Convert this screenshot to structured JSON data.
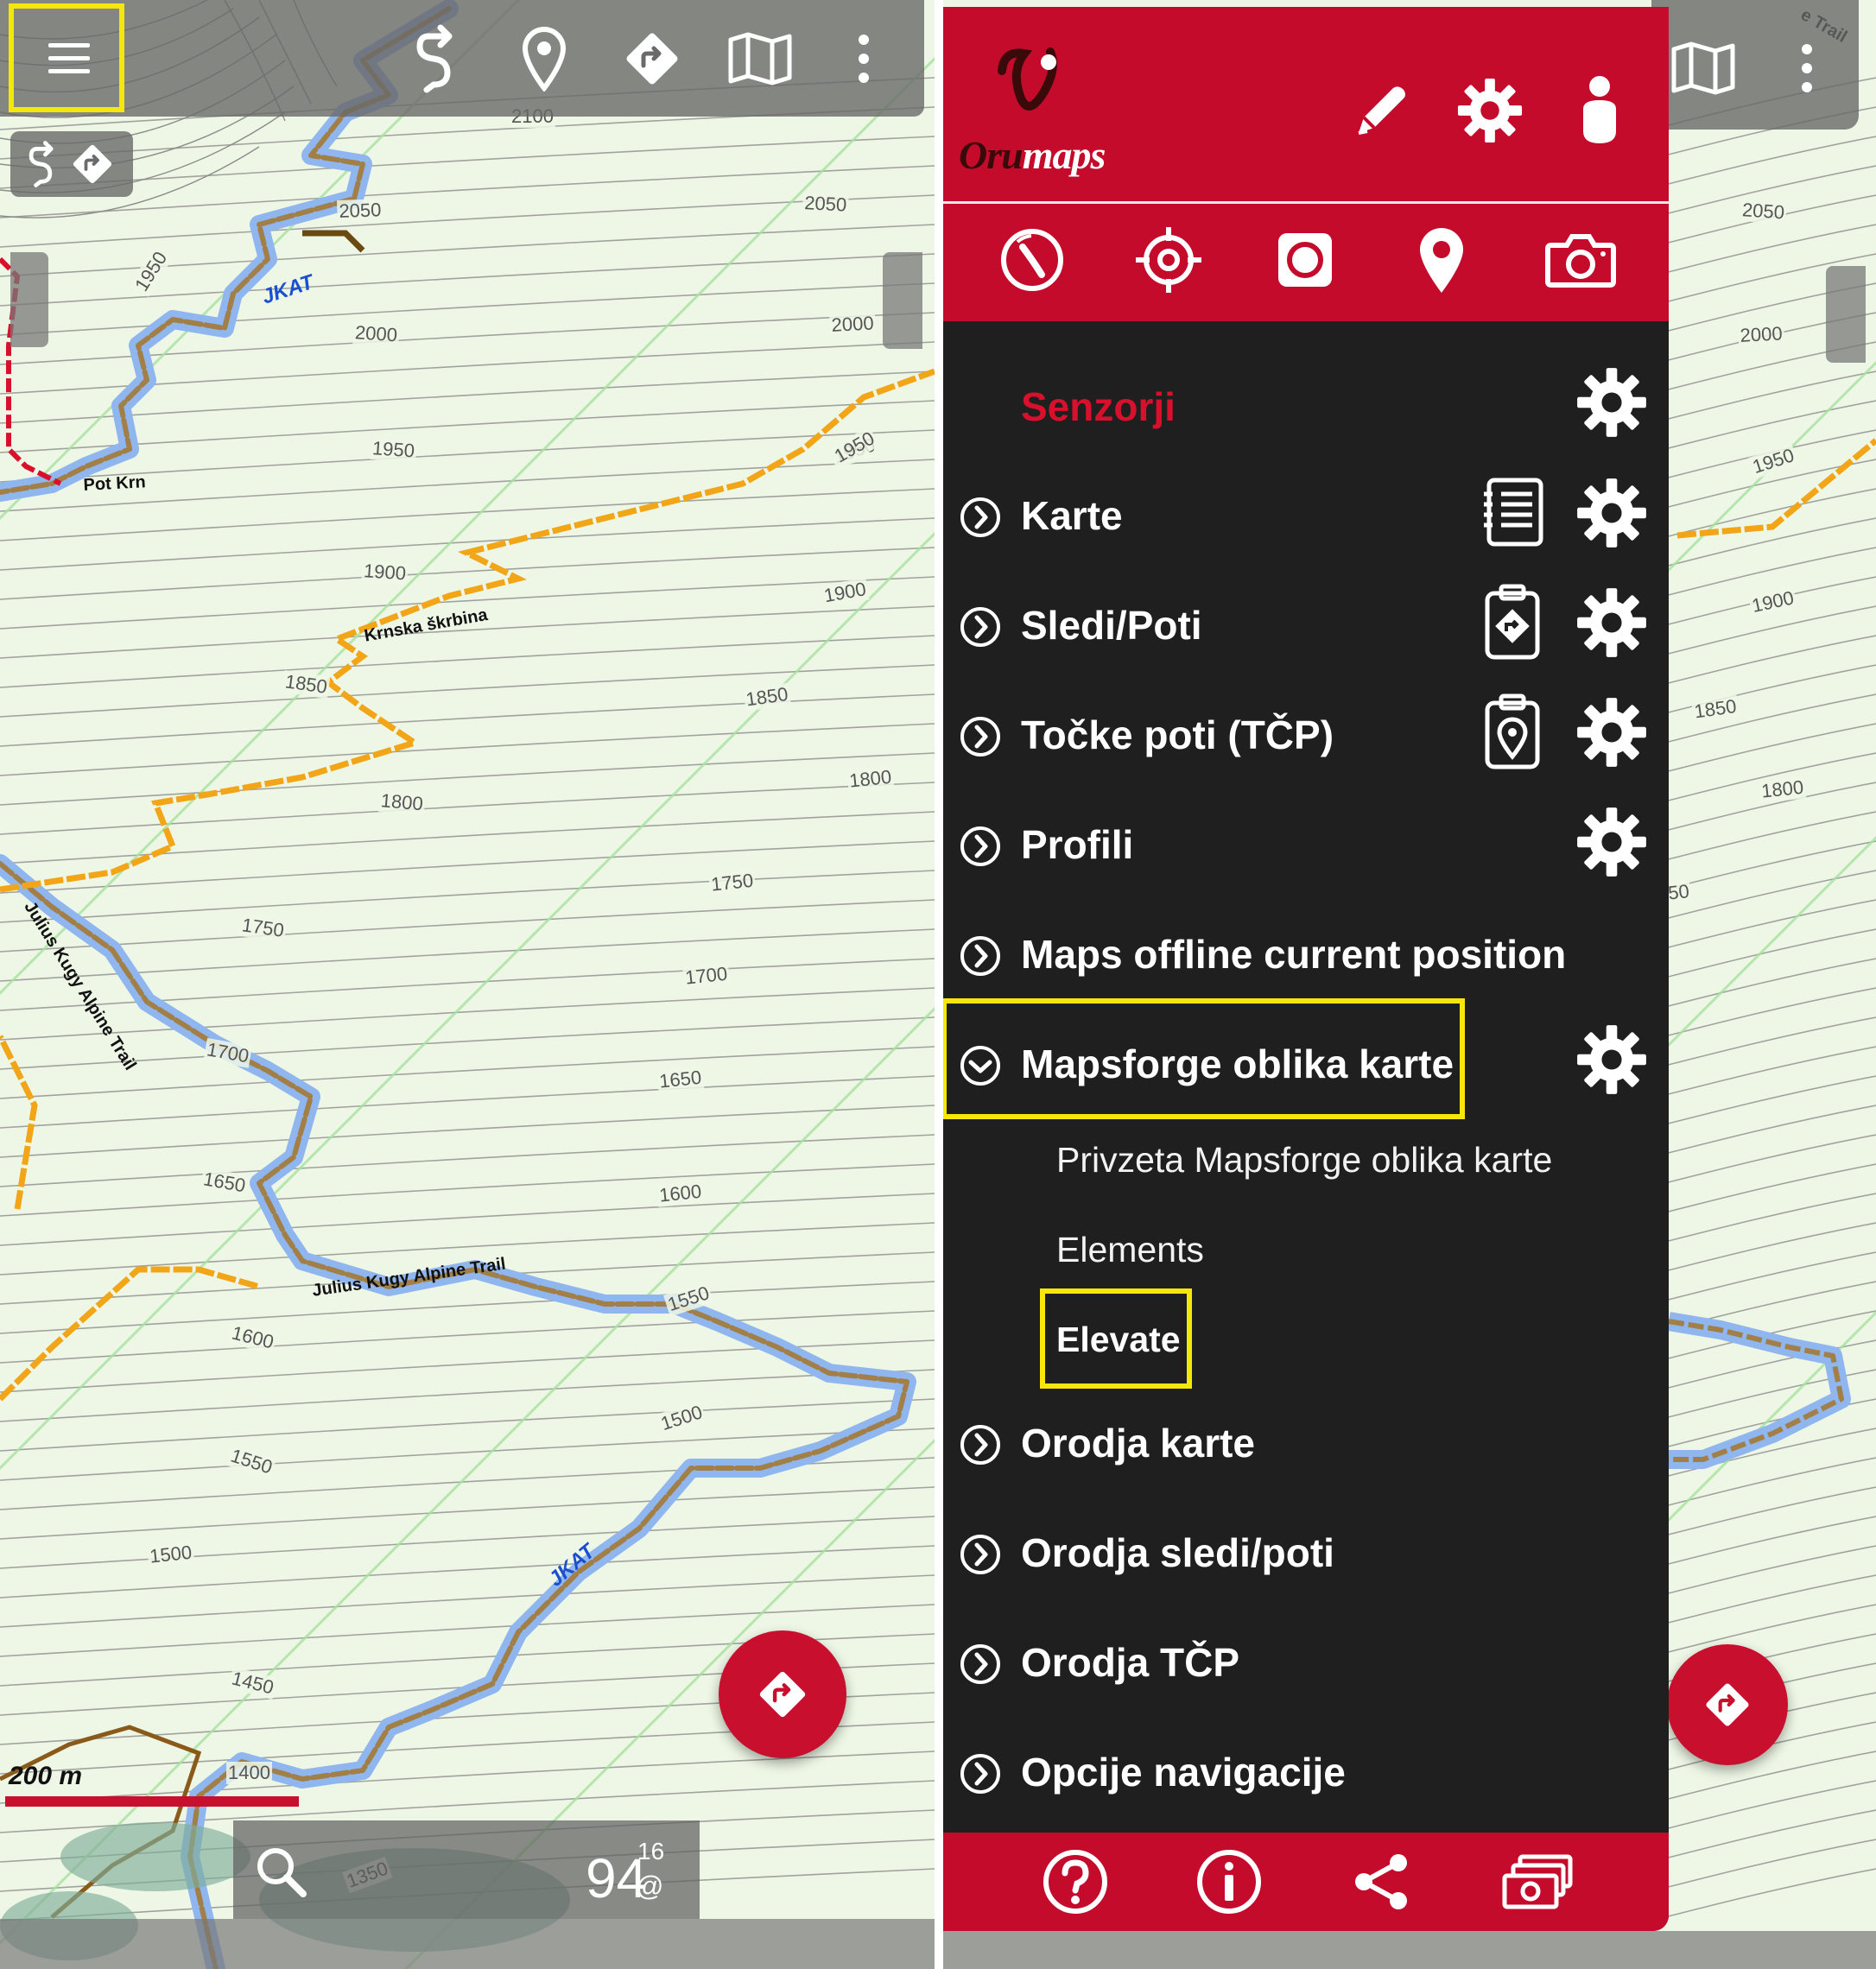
{
  "left": {
    "scale_label": "200 m",
    "zoom_level": "94",
    "zoom_superscript": "16",
    "zoom_symbol": "@",
    "contour_labels": [
      "2100",
      "2050",
      "2050",
      "2000",
      "2000",
      "1950",
      "1950",
      "1950",
      "1900",
      "1900",
      "1850",
      "1850",
      "1800",
      "1800",
      "1750",
      "1750",
      "1700",
      "1700",
      "1650",
      "1650",
      "1600",
      "1600",
      "1550",
      "1550",
      "1500",
      "1500",
      "1450",
      "1400",
      "1350",
      "1950"
    ],
    "trail_labels": [
      "JKAT",
      "Pot Krn",
      "Krnska škrbina",
      "Julius Kugy Alpine Trail",
      "Julius Kugy Alpine Trail",
      "JKAT"
    ]
  },
  "right": {
    "contour_labels": [
      "2050",
      "2000",
      "1950",
      "1900",
      "1850",
      "1800",
      "50"
    ],
    "trail_labels": [
      "e Trail"
    ]
  },
  "drawer": {
    "brand": {
      "first": "Oru",
      "second": "maps"
    },
    "header_icons": [
      "pencil-icon",
      "gear-icon",
      "person-icon"
    ],
    "quick_icons": [
      "compass-icon",
      "crosshair-icon",
      "record-icon",
      "map-pin-icon",
      "camera-icon"
    ],
    "section_title": "Senzorji",
    "items": [
      {
        "label": "Karte",
        "extra_icon": "list-icon",
        "gear": true
      },
      {
        "label": "Sledi/Poti",
        "extra_icon": "clipboard-route-icon",
        "gear": true
      },
      {
        "label": "Točke poti (TČP)",
        "extra_icon": "clipboard-pin-icon",
        "gear": true
      },
      {
        "label": "Profili",
        "gear": true
      },
      {
        "label": "Maps offline current position",
        "gear": false
      },
      {
        "label": "Mapsforge oblika karte",
        "gear": true,
        "expanded": true
      },
      {
        "label": "Orodja karte",
        "gear": false
      },
      {
        "label": "Orodja sledi/poti",
        "gear": false
      },
      {
        "label": "Orodja TČP",
        "gear": false
      },
      {
        "label": "Opcije navigacije",
        "gear": false
      }
    ],
    "subitems": [
      {
        "label": "Privzeta Mapsforge oblika karte",
        "selected": false
      },
      {
        "label": "Elements",
        "selected": false
      },
      {
        "label": "Elevate",
        "selected": true
      }
    ],
    "footer_icons": [
      "help-icon",
      "info-icon",
      "share-icon",
      "donate-icon"
    ]
  },
  "colors": {
    "brand_red": "#c50b2b",
    "drawer_bg": "#1f1f1f",
    "highlight": "#f5e60c",
    "trail_orange": "#f2a516",
    "route_blue": "#78a6e0",
    "map_bg": "#eef7e6"
  }
}
